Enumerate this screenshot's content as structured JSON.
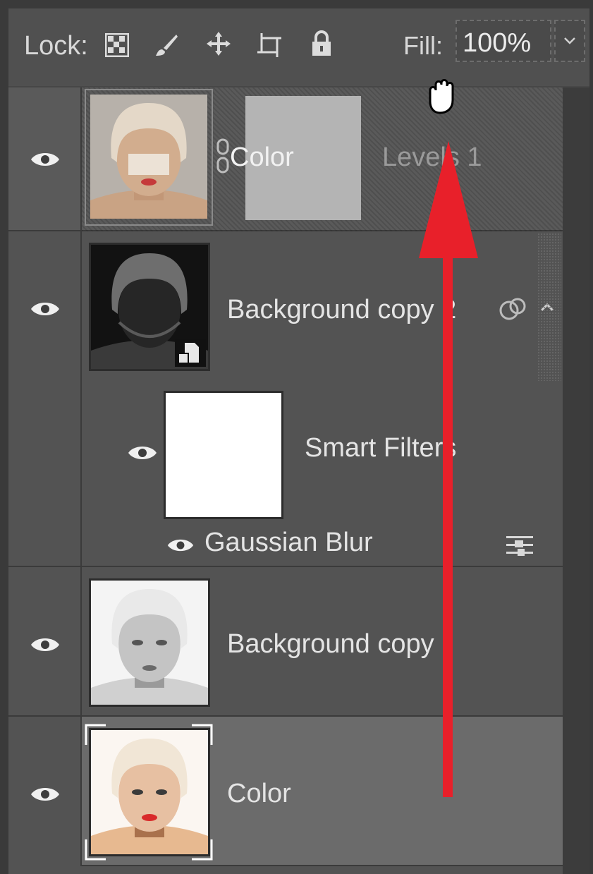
{
  "lock_bar": {
    "label": "Lock:",
    "icons": [
      "checkerboard-icon",
      "brush-icon",
      "move-icon",
      "artboard-icon",
      "lock-icon"
    ],
    "fill_label": "Fill:",
    "fill_value": "100%"
  },
  "layers": [
    {
      "name": "Levels 1",
      "mask_label": "Color",
      "type": "adjustment"
    },
    {
      "name": "Background copy 2",
      "type": "smart-object"
    },
    {
      "name": "Smart Filters",
      "type": "smart-filters"
    },
    {
      "name": "Gaussian Blur",
      "type": "filter"
    },
    {
      "name": "Background copy",
      "type": "pixel"
    },
    {
      "name": "Color",
      "type": "pixel",
      "selected": true
    }
  ],
  "colors": {
    "panel_bg": "#474747",
    "row_bg": "#535353",
    "selected_row_bg": "#6b6b6b",
    "drop_indicator": "#46a5d8",
    "arrow": "#e8202a"
  }
}
